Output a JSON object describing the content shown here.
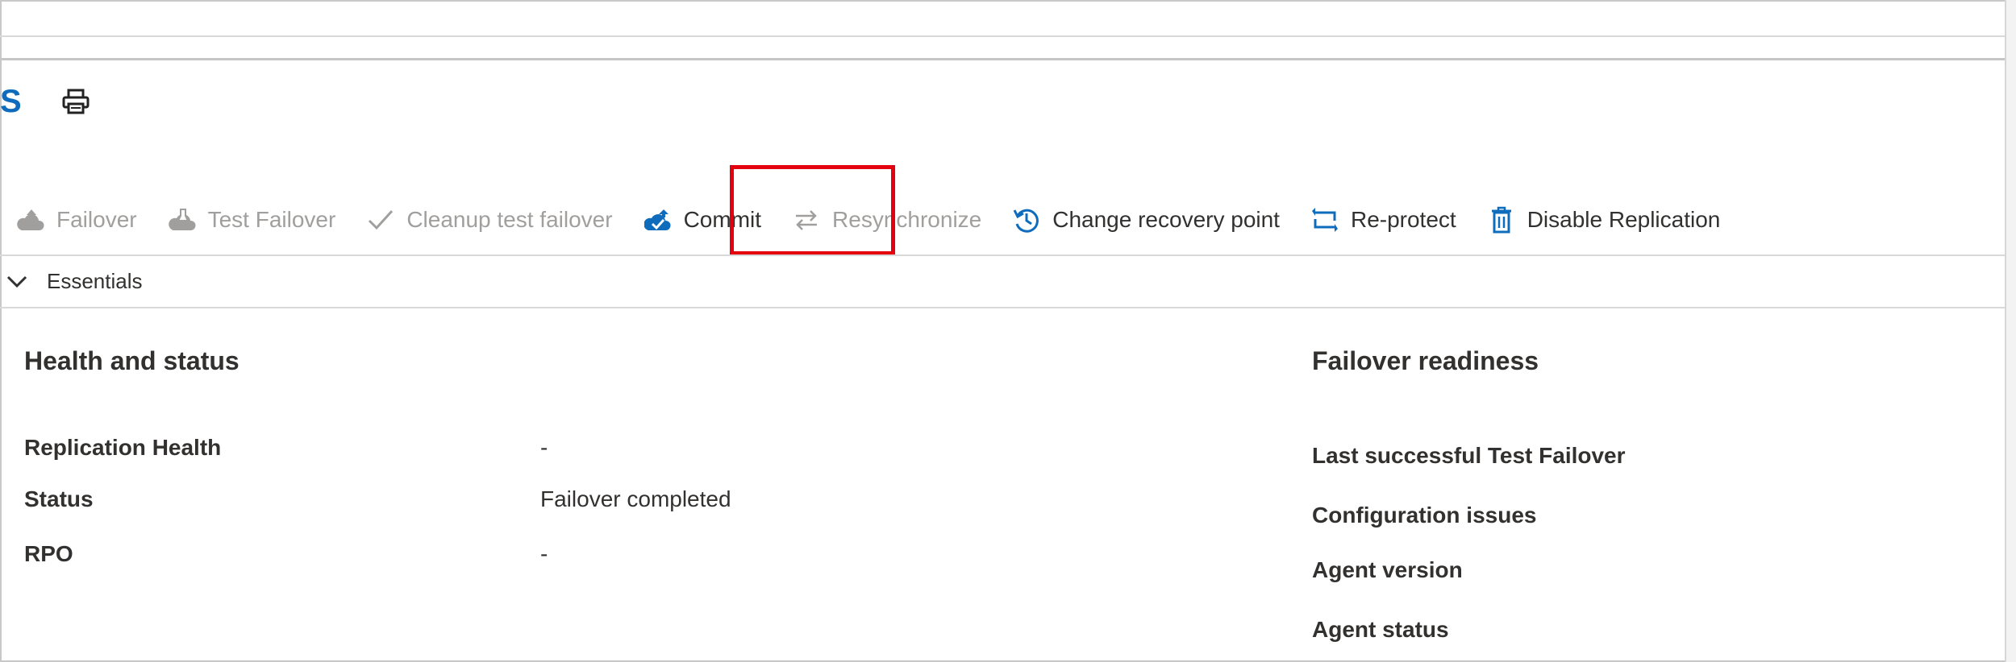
{
  "header": {
    "title_fragment": "S"
  },
  "toolbar": {
    "items": [
      {
        "label": "Failover",
        "icon": "cloud-failover-icon",
        "state": "disabled"
      },
      {
        "label": "Test Failover",
        "icon": "cloud-test-failover-icon",
        "state": "disabled"
      },
      {
        "label": "Cleanup test failover",
        "icon": "checkmark-icon",
        "state": "disabled"
      },
      {
        "label": "Commit",
        "icon": "cloud-check-icon",
        "state": "enabled",
        "highlighted": true
      },
      {
        "label": "Resynchronize",
        "icon": "swap-arrows-icon",
        "state": "disabled"
      },
      {
        "label": "Change recovery point",
        "icon": "history-clock-icon",
        "state": "enabled"
      },
      {
        "label": "Re-protect",
        "icon": "reprotect-arrows-icon",
        "state": "enabled"
      },
      {
        "label": "Disable Replication",
        "icon": "trash-icon",
        "state": "enabled"
      }
    ]
  },
  "essentials": {
    "label": "Essentials"
  },
  "health": {
    "title": "Health and status",
    "rows": [
      {
        "label": "Replication Health",
        "value": "-"
      },
      {
        "label": "Status",
        "value": "Failover completed"
      },
      {
        "label": "RPO",
        "value": "-"
      }
    ]
  },
  "readiness": {
    "title": "Failover readiness",
    "rows": [
      {
        "label": "Last successful Test Failover"
      },
      {
        "label": "Configuration issues"
      },
      {
        "label": "Agent version"
      },
      {
        "label": "Agent status"
      }
    ]
  },
  "colors": {
    "accent": "#0f6cbd",
    "highlight_box": "#e3000f",
    "disabled_text": "#a19f9d",
    "text": "#323130"
  }
}
